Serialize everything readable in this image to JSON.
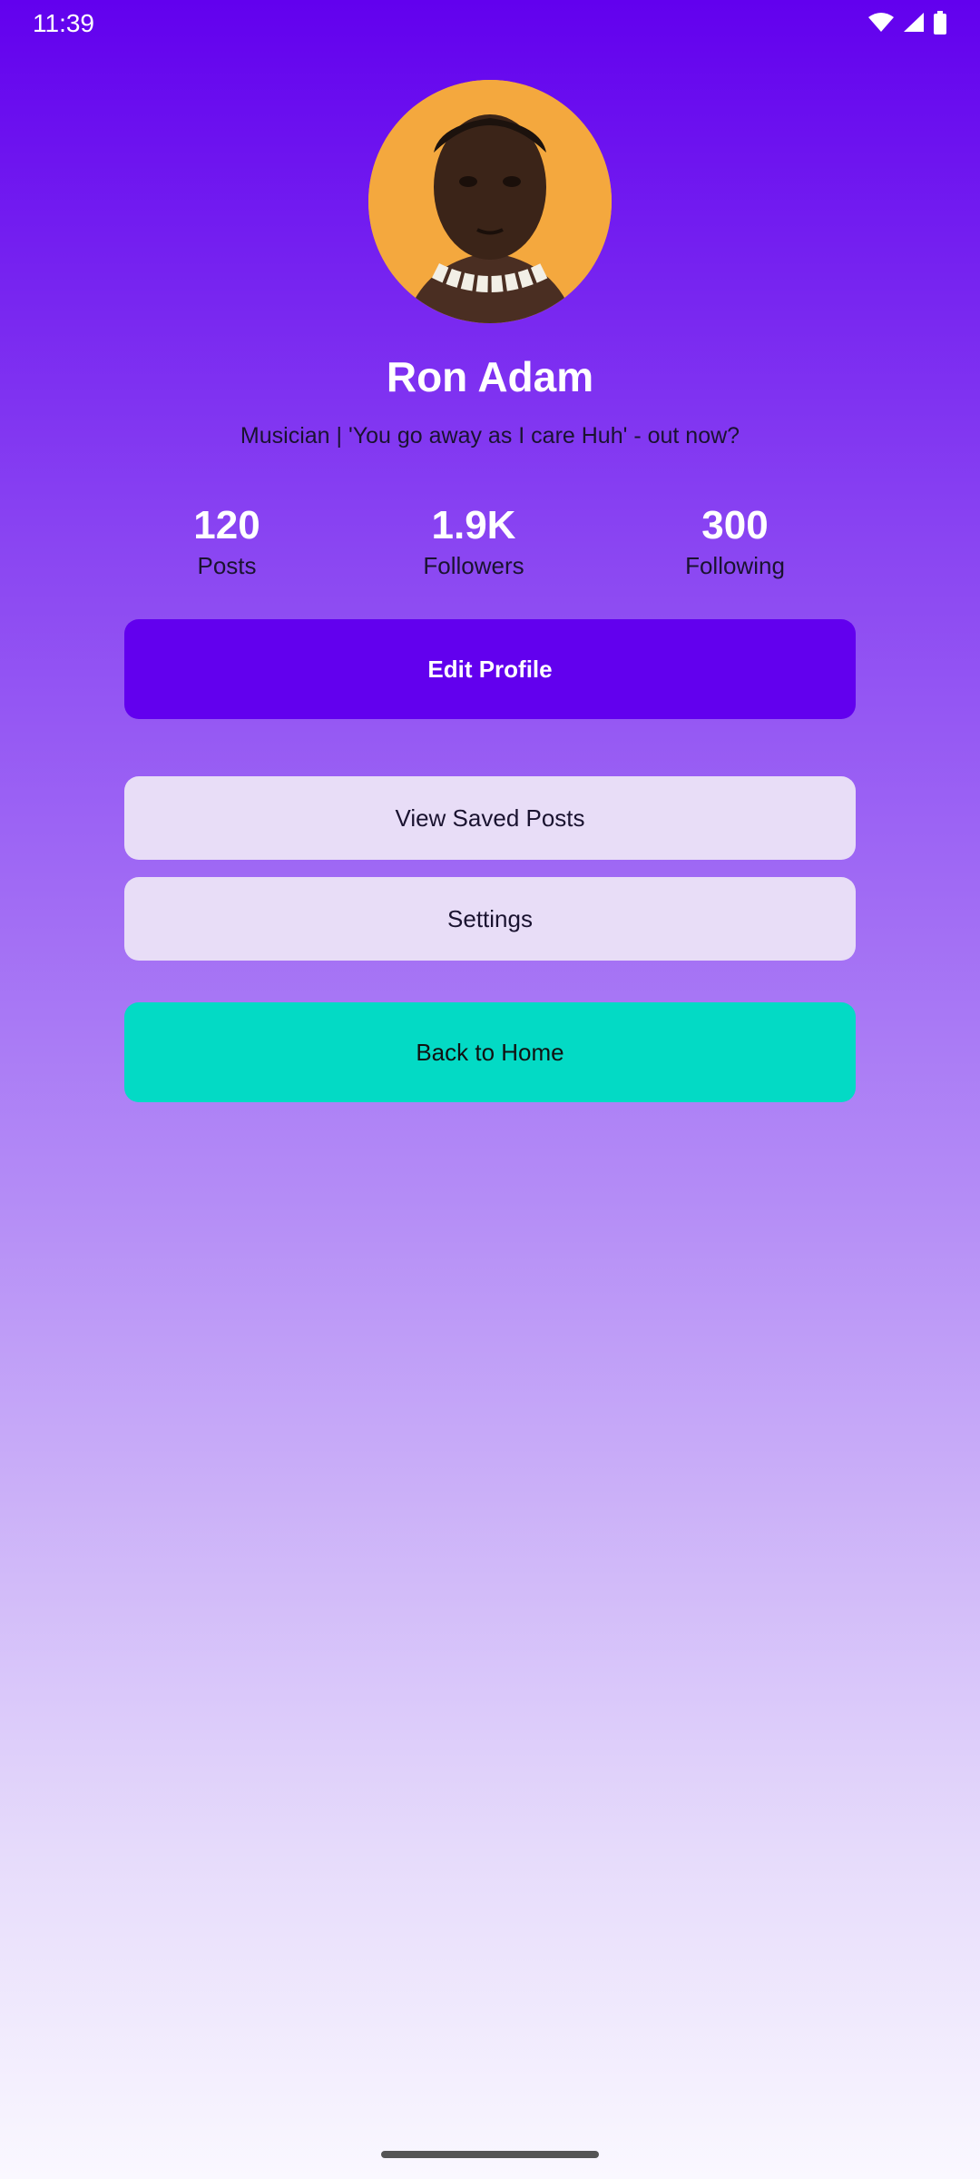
{
  "status_bar": {
    "time": "11:39",
    "icons": [
      "wifi-icon",
      "signal-icon",
      "battery-icon"
    ]
  },
  "profile": {
    "name": "Ron Adam",
    "bio": "Musician | 'You go away as I care Huh' - out now?"
  },
  "stats": [
    {
      "value": "120",
      "label": "Posts"
    },
    {
      "value": "1.9K",
      "label": "Followers"
    },
    {
      "value": "300",
      "label": "Following"
    }
  ],
  "buttons": {
    "edit_profile": "Edit Profile",
    "view_saved_posts": "View Saved Posts",
    "settings": "Settings",
    "back_to_home": "Back to Home"
  },
  "colors": {
    "primary": "#6200ee",
    "secondary": "#03dac5",
    "light_button": "#e8ddf7"
  }
}
